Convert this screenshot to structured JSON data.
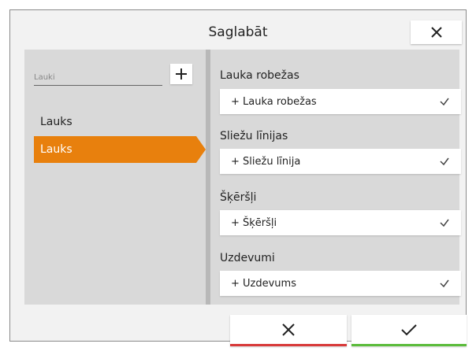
{
  "dialog": {
    "title": "Saglabāt"
  },
  "left_panel": {
    "search_placeholder": "Lauki",
    "items": [
      {
        "label": "Lauks",
        "selected": false
      },
      {
        "label": "Lauks",
        "selected": true
      }
    ]
  },
  "right_panel": {
    "sections": [
      {
        "heading": "Lauka robežas",
        "row_label": "+ Lauka robežas"
      },
      {
        "heading": "Sliežu līnijas",
        "row_label": "+ Sliežu līnija"
      },
      {
        "heading": "Šķēršļi",
        "row_label": "+ Šķēršļi"
      },
      {
        "heading": "Uzdevumi",
        "row_label": "+ Uzdevums"
      }
    ]
  },
  "colors": {
    "selected": "#e8800d",
    "cancel_accent": "#d83a3a",
    "confirm_accent": "#5cbc3c"
  },
  "icons": {
    "close": "close-icon",
    "add": "plus-icon",
    "check": "check-icon",
    "cancel": "x-icon",
    "confirm": "check-icon"
  }
}
